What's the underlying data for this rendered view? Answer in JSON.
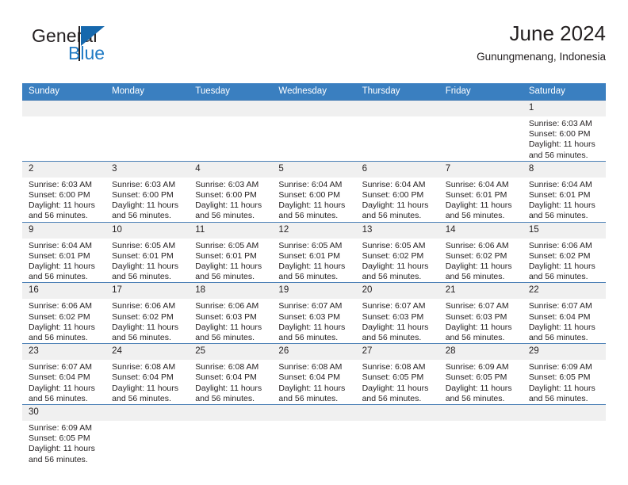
{
  "brand": {
    "word_general": "General",
    "word_blue": "Blue",
    "flag_color": "#1668ad",
    "blue_color": "#1f7ac4"
  },
  "header": {
    "title": "June 2024",
    "subtitle": "Gunungmenang, Indonesia"
  },
  "theme": {
    "header_row_bg": "#3a7fc0",
    "daynum_bg": "#f0f0f0",
    "row_border": "#4a7fb5"
  },
  "calendar": {
    "weekday_headers": [
      "Sunday",
      "Monday",
      "Tuesday",
      "Wednesday",
      "Thursday",
      "Friday",
      "Saturday"
    ],
    "labels": {
      "sunrise": "Sunrise:",
      "sunset": "Sunset:",
      "daylight": "Daylight:"
    },
    "weeks": [
      [
        {
          "day": "",
          "blank": true
        },
        {
          "day": "",
          "blank": true
        },
        {
          "day": "",
          "blank": true
        },
        {
          "day": "",
          "blank": true
        },
        {
          "day": "",
          "blank": true
        },
        {
          "day": "",
          "blank": true
        },
        {
          "day": "1",
          "sunrise": "Sunrise: 6:03 AM",
          "sunset": "Sunset: 6:00 PM",
          "daylight_1": "Daylight: 11 hours",
          "daylight_2": "and 56 minutes."
        }
      ],
      [
        {
          "day": "2",
          "sunrise": "Sunrise: 6:03 AM",
          "sunset": "Sunset: 6:00 PM",
          "daylight_1": "Daylight: 11 hours",
          "daylight_2": "and 56 minutes."
        },
        {
          "day": "3",
          "sunrise": "Sunrise: 6:03 AM",
          "sunset": "Sunset: 6:00 PM",
          "daylight_1": "Daylight: 11 hours",
          "daylight_2": "and 56 minutes."
        },
        {
          "day": "4",
          "sunrise": "Sunrise: 6:03 AM",
          "sunset": "Sunset: 6:00 PM",
          "daylight_1": "Daylight: 11 hours",
          "daylight_2": "and 56 minutes."
        },
        {
          "day": "5",
          "sunrise": "Sunrise: 6:04 AM",
          "sunset": "Sunset: 6:00 PM",
          "daylight_1": "Daylight: 11 hours",
          "daylight_2": "and 56 minutes."
        },
        {
          "day": "6",
          "sunrise": "Sunrise: 6:04 AM",
          "sunset": "Sunset: 6:00 PM",
          "daylight_1": "Daylight: 11 hours",
          "daylight_2": "and 56 minutes."
        },
        {
          "day": "7",
          "sunrise": "Sunrise: 6:04 AM",
          "sunset": "Sunset: 6:01 PM",
          "daylight_1": "Daylight: 11 hours",
          "daylight_2": "and 56 minutes."
        },
        {
          "day": "8",
          "sunrise": "Sunrise: 6:04 AM",
          "sunset": "Sunset: 6:01 PM",
          "daylight_1": "Daylight: 11 hours",
          "daylight_2": "and 56 minutes."
        }
      ],
      [
        {
          "day": "9",
          "sunrise": "Sunrise: 6:04 AM",
          "sunset": "Sunset: 6:01 PM",
          "daylight_1": "Daylight: 11 hours",
          "daylight_2": "and 56 minutes."
        },
        {
          "day": "10",
          "sunrise": "Sunrise: 6:05 AM",
          "sunset": "Sunset: 6:01 PM",
          "daylight_1": "Daylight: 11 hours",
          "daylight_2": "and 56 minutes."
        },
        {
          "day": "11",
          "sunrise": "Sunrise: 6:05 AM",
          "sunset": "Sunset: 6:01 PM",
          "daylight_1": "Daylight: 11 hours",
          "daylight_2": "and 56 minutes."
        },
        {
          "day": "12",
          "sunrise": "Sunrise: 6:05 AM",
          "sunset": "Sunset: 6:01 PM",
          "daylight_1": "Daylight: 11 hours",
          "daylight_2": "and 56 minutes."
        },
        {
          "day": "13",
          "sunrise": "Sunrise: 6:05 AM",
          "sunset": "Sunset: 6:02 PM",
          "daylight_1": "Daylight: 11 hours",
          "daylight_2": "and 56 minutes."
        },
        {
          "day": "14",
          "sunrise": "Sunrise: 6:06 AM",
          "sunset": "Sunset: 6:02 PM",
          "daylight_1": "Daylight: 11 hours",
          "daylight_2": "and 56 minutes."
        },
        {
          "day": "15",
          "sunrise": "Sunrise: 6:06 AM",
          "sunset": "Sunset: 6:02 PM",
          "daylight_1": "Daylight: 11 hours",
          "daylight_2": "and 56 minutes."
        }
      ],
      [
        {
          "day": "16",
          "sunrise": "Sunrise: 6:06 AM",
          "sunset": "Sunset: 6:02 PM",
          "daylight_1": "Daylight: 11 hours",
          "daylight_2": "and 56 minutes."
        },
        {
          "day": "17",
          "sunrise": "Sunrise: 6:06 AM",
          "sunset": "Sunset: 6:02 PM",
          "daylight_1": "Daylight: 11 hours",
          "daylight_2": "and 56 minutes."
        },
        {
          "day": "18",
          "sunrise": "Sunrise: 6:06 AM",
          "sunset": "Sunset: 6:03 PM",
          "daylight_1": "Daylight: 11 hours",
          "daylight_2": "and 56 minutes."
        },
        {
          "day": "19",
          "sunrise": "Sunrise: 6:07 AM",
          "sunset": "Sunset: 6:03 PM",
          "daylight_1": "Daylight: 11 hours",
          "daylight_2": "and 56 minutes."
        },
        {
          "day": "20",
          "sunrise": "Sunrise: 6:07 AM",
          "sunset": "Sunset: 6:03 PM",
          "daylight_1": "Daylight: 11 hours",
          "daylight_2": "and 56 minutes."
        },
        {
          "day": "21",
          "sunrise": "Sunrise: 6:07 AM",
          "sunset": "Sunset: 6:03 PM",
          "daylight_1": "Daylight: 11 hours",
          "daylight_2": "and 56 minutes."
        },
        {
          "day": "22",
          "sunrise": "Sunrise: 6:07 AM",
          "sunset": "Sunset: 6:04 PM",
          "daylight_1": "Daylight: 11 hours",
          "daylight_2": "and 56 minutes."
        }
      ],
      [
        {
          "day": "23",
          "sunrise": "Sunrise: 6:07 AM",
          "sunset": "Sunset: 6:04 PM",
          "daylight_1": "Daylight: 11 hours",
          "daylight_2": "and 56 minutes."
        },
        {
          "day": "24",
          "sunrise": "Sunrise: 6:08 AM",
          "sunset": "Sunset: 6:04 PM",
          "daylight_1": "Daylight: 11 hours",
          "daylight_2": "and 56 minutes."
        },
        {
          "day": "25",
          "sunrise": "Sunrise: 6:08 AM",
          "sunset": "Sunset: 6:04 PM",
          "daylight_1": "Daylight: 11 hours",
          "daylight_2": "and 56 minutes."
        },
        {
          "day": "26",
          "sunrise": "Sunrise: 6:08 AM",
          "sunset": "Sunset: 6:04 PM",
          "daylight_1": "Daylight: 11 hours",
          "daylight_2": "and 56 minutes."
        },
        {
          "day": "27",
          "sunrise": "Sunrise: 6:08 AM",
          "sunset": "Sunset: 6:05 PM",
          "daylight_1": "Daylight: 11 hours",
          "daylight_2": "and 56 minutes."
        },
        {
          "day": "28",
          "sunrise": "Sunrise: 6:09 AM",
          "sunset": "Sunset: 6:05 PM",
          "daylight_1": "Daylight: 11 hours",
          "daylight_2": "and 56 minutes."
        },
        {
          "day": "29",
          "sunrise": "Sunrise: 6:09 AM",
          "sunset": "Sunset: 6:05 PM",
          "daylight_1": "Daylight: 11 hours",
          "daylight_2": "and 56 minutes."
        }
      ],
      [
        {
          "day": "30",
          "sunrise": "Sunrise: 6:09 AM",
          "sunset": "Sunset: 6:05 PM",
          "daylight_1": "Daylight: 11 hours",
          "daylight_2": "and 56 minutes."
        },
        {
          "day": "",
          "blank": true
        },
        {
          "day": "",
          "blank": true
        },
        {
          "day": "",
          "blank": true
        },
        {
          "day": "",
          "blank": true
        },
        {
          "day": "",
          "blank": true
        },
        {
          "day": "",
          "blank": true
        }
      ]
    ]
  }
}
